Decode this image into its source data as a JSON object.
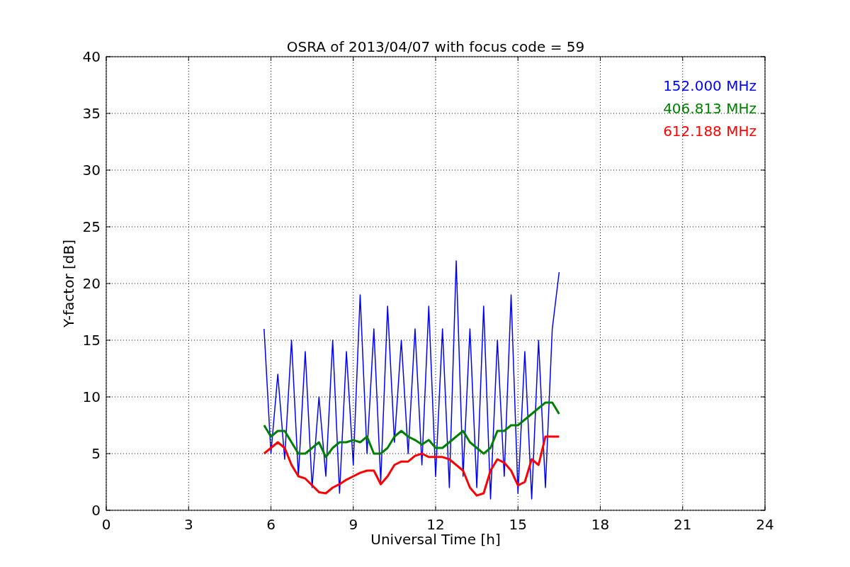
{
  "figure": {
    "chart_data": {
      "type": "line",
      "title": "OSRA of 2013/04/07 with focus code = 59",
      "xlabel": "Universal Time [h]",
      "ylabel": "Y-factor [dB]",
      "xlim": [
        0,
        24
      ],
      "ylim": [
        0,
        40
      ],
      "xticks": [
        0,
        3,
        6,
        9,
        12,
        15,
        18,
        21,
        24
      ],
      "yticks": [
        0,
        5,
        10,
        15,
        20,
        25,
        30,
        35,
        40
      ],
      "grid": true,
      "x": [
        5.75,
        6,
        6.25,
        6.5,
        6.75,
        7,
        7.25,
        7.5,
        7.75,
        8,
        8.25,
        8.5,
        8.75,
        9,
        9.25,
        9.5,
        9.75,
        10,
        10.25,
        10.5,
        10.75,
        11,
        11.25,
        11.5,
        11.75,
        12,
        12.25,
        12.5,
        12.75,
        13,
        13.25,
        13.5,
        13.75,
        14,
        14.25,
        14.5,
        14.75,
        15,
        15.25,
        15.5,
        15.75,
        16,
        16.25,
        16.5
      ],
      "series": [
        {
          "name": "152.000 MHz",
          "color": "#0000ff",
          "values": [
            16,
            5,
            12,
            4.5,
            15,
            3,
            14,
            2,
            10,
            3,
            15,
            1.5,
            14,
            4,
            19,
            5,
            16,
            2.5,
            18,
            6,
            15,
            5,
            16,
            4,
            18,
            3,
            16,
            2,
            22,
            3,
            16,
            2,
            18,
            1,
            15,
            3,
            19,
            1.5,
            14,
            1,
            15,
            2,
            16,
            21
          ]
        },
        {
          "name": "406.813 MHz",
          "color": "#008000",
          "values": [
            7.5,
            6.5,
            7,
            7,
            6,
            5,
            5,
            5.5,
            6,
            4.7,
            5.5,
            6,
            6,
            6.2,
            6,
            6.5,
            5,
            5,
            5.5,
            6.5,
            7,
            6.5,
            6.2,
            5.8,
            6.2,
            5.5,
            5.5,
            6,
            6.5,
            7,
            6,
            5.5,
            5,
            5.5,
            7,
            7,
            7.5,
            7.5,
            8,
            8.5,
            9,
            9.5,
            9.5,
            8.5
          ]
        },
        {
          "name": "612.188 MHz",
          "color": "#ff0000",
          "values": [
            5,
            5.5,
            6,
            5.5,
            4,
            3,
            2.8,
            2.2,
            1.6,
            1.5,
            2,
            2.3,
            2.7,
            3,
            3.3,
            3.5,
            3.5,
            2.3,
            3,
            4,
            4.3,
            4.3,
            4.8,
            5,
            4.7,
            4.7,
            4.7,
            4.5,
            4,
            3.5,
            2,
            1.3,
            1.5,
            3.5,
            4.5,
            4.2,
            3.5,
            2.2,
            2.5,
            4.5,
            4,
            6.5,
            6.5,
            6.5
          ]
        }
      ]
    }
  }
}
